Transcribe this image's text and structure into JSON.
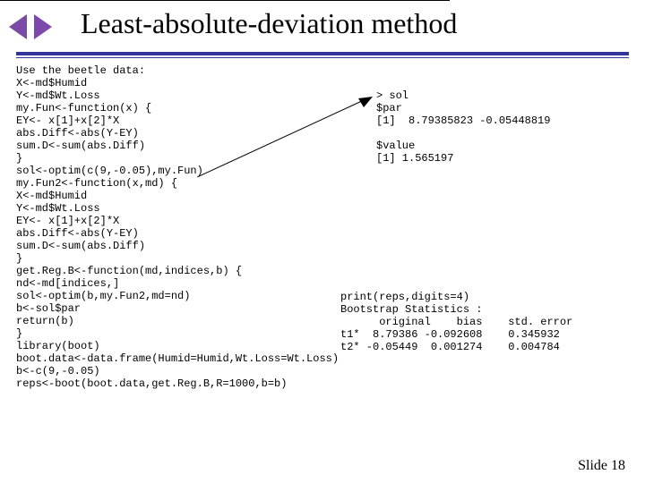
{
  "title": "Least-absolute-deviation method",
  "code_left": "Use the beetle data:\nX<-md$Humid\nY<-md$Wt.Loss\nmy.Fun<-function(x) {\nEY<- x[1]+x[2]*X\nabs.Diff<-abs(Y-EY)\nsum.D<-sum(abs.Diff)\n}\nsol<-optim(c(9,-0.05),my.Fun)\nmy.Fun2<-function(x,md) {\nX<-md$Humid\nY<-md$Wt.Loss\nEY<- x[1]+x[2]*X\nabs.Diff<-abs(Y-EY)\nsum.D<-sum(abs.Diff)\n}\nget.Reg.B<-function(md,indices,b) {\nnd<-md[indices,]\nsol<-optim(b,my.Fun2,md=nd)\nb<-sol$par\nreturn(b)\n}\nlibrary(boot)\nboot.data<-data.frame(Humid=Humid,Wt.Loss=Wt.Loss)\nb<-c(9,-0.05)\nreps<-boot(boot.data,get.Reg.B,R=1000,b=b)",
  "out_top": "> sol\n$par\n[1]  8.79385823 -0.05448819\n\n$value\n[1] 1.565197",
  "out_bottom": "print(reps,digits=4)\nBootstrap Statistics :\n      original    bias    std. error\nt1*  8.79386 -0.092608    0.345932\nt2* -0.05449  0.001274    0.004784",
  "slide_num": "Slide 18"
}
